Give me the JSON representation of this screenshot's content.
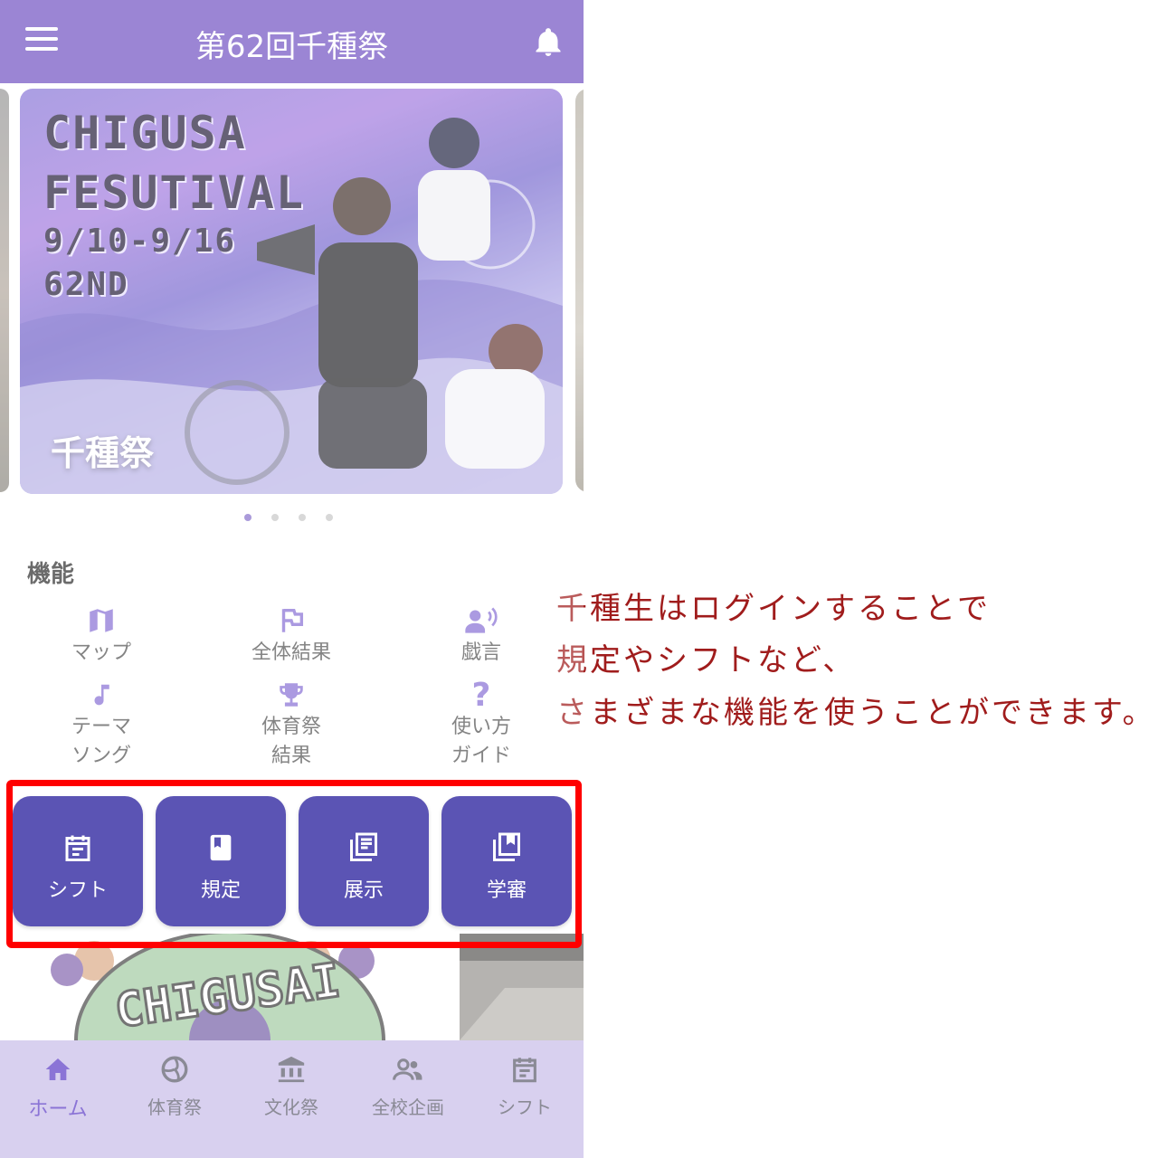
{
  "app": {
    "title": "第62回千種祭"
  },
  "carousel": {
    "hero_lines": [
      "CHIGUSA",
      "FESUTIVAL",
      "9/10-9/16",
      "62ND"
    ],
    "caption": "千種祭",
    "page_count": 4,
    "active_index": 0
  },
  "features": {
    "title": "機能",
    "items": [
      {
        "label": "マップ",
        "icon": "map-icon"
      },
      {
        "label": "全体結果",
        "icon": "flag-icon"
      },
      {
        "label": "戯言",
        "icon": "record-voice-icon"
      },
      {
        "label": "テーマ\nソング",
        "icon": "music-note-icon"
      },
      {
        "label": "体育祭\n結果",
        "icon": "trophy-icon"
      },
      {
        "label": "使い方\nガイド",
        "icon": "help-icon"
      }
    ]
  },
  "quick_tiles": [
    {
      "label": "シフト",
      "icon": "calendar-icon"
    },
    {
      "label": "規定",
      "icon": "book-icon"
    },
    {
      "label": "展示",
      "icon": "library-books-icon"
    },
    {
      "label": "学審",
      "icon": "collections-bookmark-icon"
    }
  ],
  "news": {
    "left_text": "CHIGUSAI"
  },
  "bottom_nav": [
    {
      "label": "ホーム",
      "icon": "home-icon",
      "active": true
    },
    {
      "label": "体育祭",
      "icon": "volleyball-icon",
      "active": false
    },
    {
      "label": "文化祭",
      "icon": "institution-icon",
      "active": false
    },
    {
      "label": "全校企画",
      "icon": "group-icon",
      "active": false
    },
    {
      "label": "シフト",
      "icon": "calendar-icon",
      "active": false
    }
  ],
  "annotation": {
    "lines": [
      "千種生はログインすることで",
      "規定やシフトなど、",
      "さまざまな機能を使うことができます。"
    ]
  },
  "colors": {
    "appbar": "#9b85d4",
    "accent": "#8a74cc",
    "tile": "#5b54b4",
    "highlight": "#ff0000",
    "annotation": "#a01c1c",
    "bottom_nav": "#d8d0ef"
  }
}
